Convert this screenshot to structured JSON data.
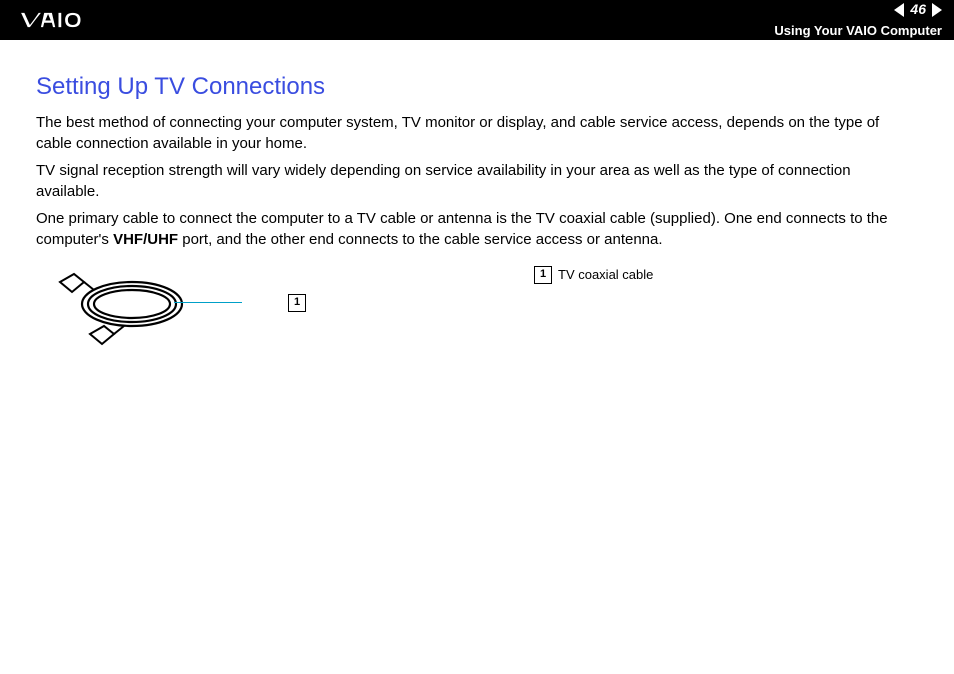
{
  "header": {
    "page_number": "46",
    "section": "Using Your VAIO Computer"
  },
  "content": {
    "title": "Setting Up TV Connections",
    "para1": "The best method of connecting your computer system, TV monitor or display, and cable service access, depends on the type of cable connection available in your home.",
    "para2": "TV signal reception strength will vary widely depending on service availability in your area as well as the type of connection available.",
    "para3a": "One primary cable to connect the computer to a TV cable or antenna is the TV coaxial cable (supplied). One end connects to the computer's ",
    "para3b": "VHF/UHF",
    "para3c": " port, and the other end connects to the cable service access or antenna."
  },
  "diagram": {
    "callout_number": "1",
    "legend_number": "1",
    "legend_label": "TV coaxial cable"
  }
}
